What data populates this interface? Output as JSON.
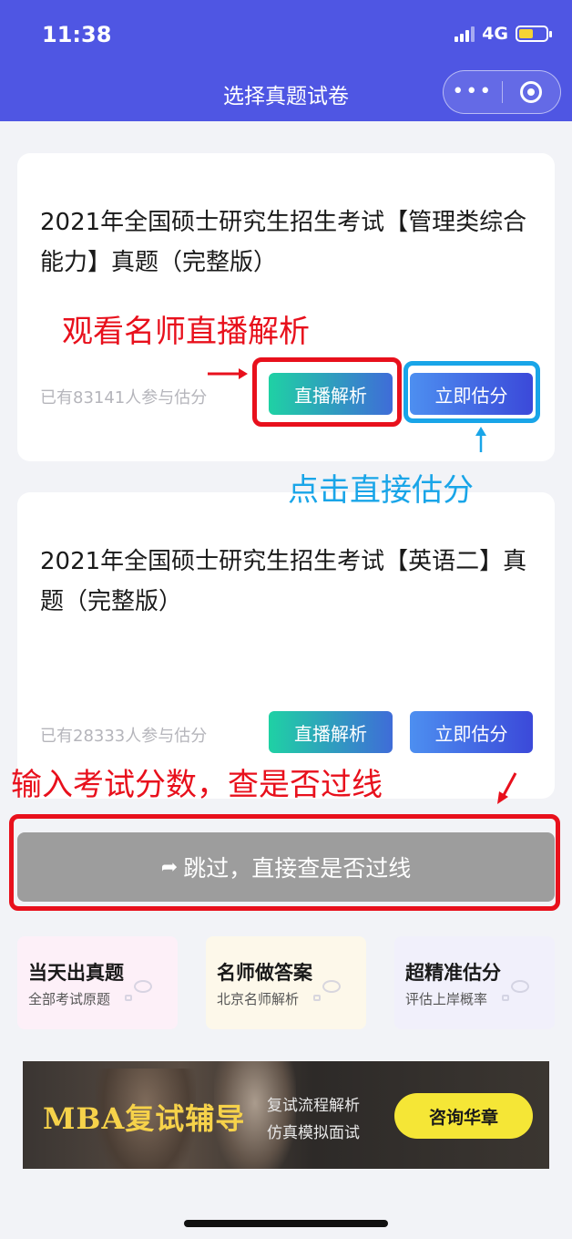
{
  "status_bar": {
    "time": "11:38",
    "network": "4G"
  },
  "nav": {
    "title": "选择真题试卷",
    "more_icon": "more-dots-icon",
    "target_icon": "target-icon"
  },
  "cards": [
    {
      "title": "2021年全国硕士研究生招生考试【管理类综合能力】真题（完整版）",
      "count": "已有83141人参与估分",
      "live_label": "直播解析",
      "score_label": "立即估分"
    },
    {
      "title": "2021年全国硕士研究生招生考试【英语二】真题（完整版）",
      "count": "已有28333人参与估分",
      "live_label": "直播解析",
      "score_label": "立即估分"
    }
  ],
  "skip": {
    "label": "跳过，直接查是否过线",
    "icon": "share-arrow-icon"
  },
  "features": [
    {
      "title": "当天出真题",
      "subtitle": "全部考试原题",
      "bg": "#fdf0f8"
    },
    {
      "title": "名师做答案",
      "subtitle": "北京名师解析",
      "bg": "#fdf8ea"
    },
    {
      "title": "超精准估分",
      "subtitle": "评估上岸概率",
      "bg": "#f1f0fb"
    }
  ],
  "banner": {
    "title": "MBA复试辅导",
    "lines": [
      "复试流程解析",
      "仿真模拟面试"
    ],
    "button": "咨询华章"
  },
  "annotations": {
    "watch_live": "观看名师直播解析",
    "click_score": "点击直接估分",
    "enter_score": "输入考试分数，查是否过线"
  },
  "colors": {
    "nav_bg": "#4f56e3",
    "annotation_red": "#e8101c",
    "annotation_blue": "#19a5e8",
    "banner_button": "#f5e636"
  }
}
